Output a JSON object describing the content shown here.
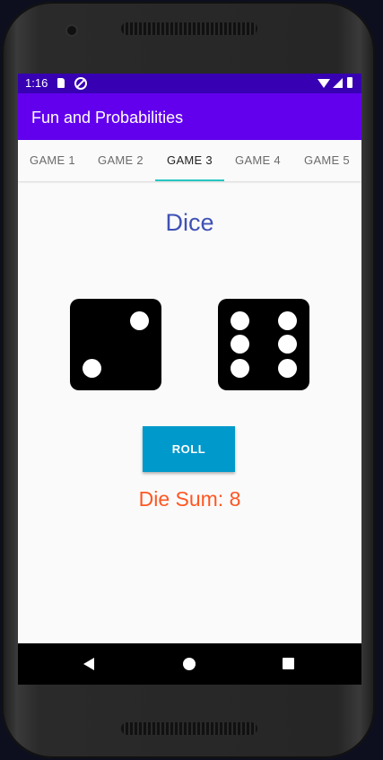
{
  "status_bar": {
    "time": "1:16"
  },
  "app_bar": {
    "title": "Fun and Probabilities"
  },
  "tabs": [
    {
      "label": "GAME 1",
      "active": false
    },
    {
      "label": "GAME 2",
      "active": false
    },
    {
      "label": "GAME 3",
      "active": true
    },
    {
      "label": "GAME 4",
      "active": false
    },
    {
      "label": "GAME 5",
      "active": false
    }
  ],
  "game": {
    "heading": "Dice",
    "dice": [
      2,
      6
    ],
    "roll_label": "ROLL",
    "sum_text": "Die Sum: 8"
  },
  "colors": {
    "status_bar": "#3700b3",
    "app_bar": "#6200ee",
    "tab_indicator": "#26c6c3",
    "heading": "#3f51b5",
    "roll_button": "#0099cc",
    "sum_text": "#ff5722"
  },
  "icons": {
    "status": [
      "sd-card-icon",
      "sync-disabled-icon",
      "wifi-icon",
      "signal-icon",
      "battery-icon"
    ],
    "nav": [
      "back-icon",
      "home-icon",
      "recents-icon"
    ]
  }
}
